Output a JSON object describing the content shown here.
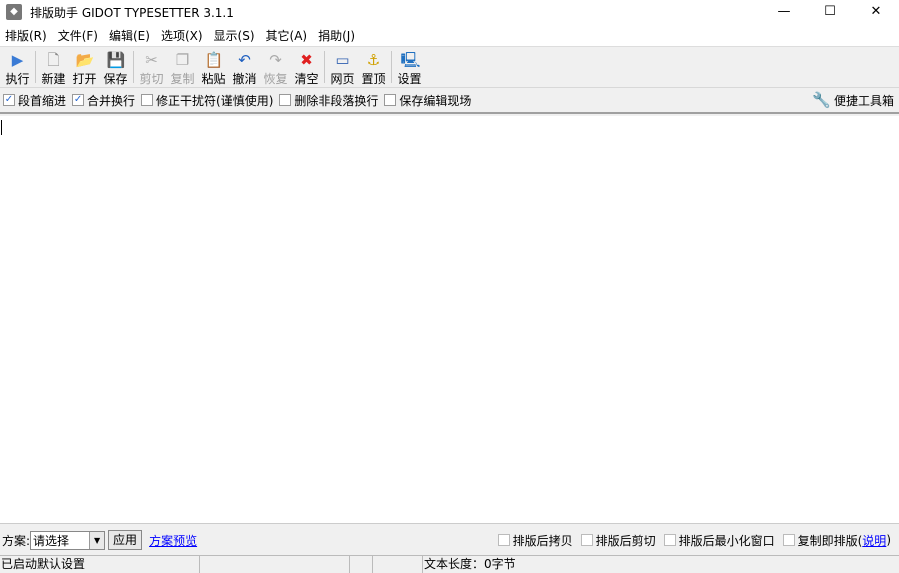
{
  "title": "排版助手 GIDOT TYPESETTER 3.1.1",
  "window_controls": {
    "minimize": "—",
    "maximize": "☐",
    "close": "✕"
  },
  "menu": [
    "排版(R)",
    "文件(F)",
    "编辑(E)",
    "选项(X)",
    "显示(S)",
    "其它(A)",
    "捐助(J)"
  ],
  "toolbar": [
    {
      "label": "执行",
      "icon": "▶",
      "color": "#3a7bd5",
      "enabled": true
    },
    {
      "label": "新建",
      "icon": "🗋",
      "color": "#888",
      "enabled": true
    },
    {
      "label": "打开",
      "icon": "📂",
      "color": "#e0a030",
      "enabled": true
    },
    {
      "label": "保存",
      "icon": "💾",
      "color": "#3060b0",
      "enabled": true
    },
    {
      "label": "剪切",
      "icon": "✂",
      "color": "#aaa",
      "enabled": false
    },
    {
      "label": "复制",
      "icon": "❐",
      "color": "#aaa",
      "enabled": false
    },
    {
      "label": "粘贴",
      "icon": "📋",
      "color": "#c08030",
      "enabled": true
    },
    {
      "label": "撤消",
      "icon": "↶",
      "color": "#2060c0",
      "enabled": true
    },
    {
      "label": "恢复",
      "icon": "↷",
      "color": "#aaa",
      "enabled": false
    },
    {
      "label": "清空",
      "icon": "✖",
      "color": "#e02020",
      "enabled": true
    },
    {
      "label": "网页",
      "icon": "▭",
      "color": "#3060b0",
      "enabled": true
    },
    {
      "label": "置顶",
      "icon": "⚓",
      "color": "#d0a000",
      "enabled": true
    },
    {
      "label": "设置",
      "icon": "🖳",
      "color": "#2070c0",
      "enabled": true
    }
  ],
  "options": [
    {
      "label": "段首缩进",
      "checked": true
    },
    {
      "label": "合并换行",
      "checked": true
    },
    {
      "label": "修正干扰符(谨慎使用)",
      "checked": false
    },
    {
      "label": "删除非段落换行",
      "checked": false
    },
    {
      "label": "保存编辑现场",
      "checked": false
    }
  ],
  "quick_tools": "便捷工具箱",
  "editor": {
    "content": ""
  },
  "bottom": {
    "scheme_label": "方案:",
    "scheme_value": "请选择",
    "apply": "应用",
    "preview_link": "方案预览",
    "after": [
      {
        "label": "排版后拷贝",
        "checked": false
      },
      {
        "label": "排版后剪切",
        "checked": false
      },
      {
        "label": "排版后最小化窗口",
        "checked": false
      }
    ],
    "copy_typeset": "复制即排版(",
    "help_link": "说明",
    "close_paren": ")"
  },
  "status": {
    "message": "已启动默认设置",
    "length": "文本长度：0字节"
  }
}
